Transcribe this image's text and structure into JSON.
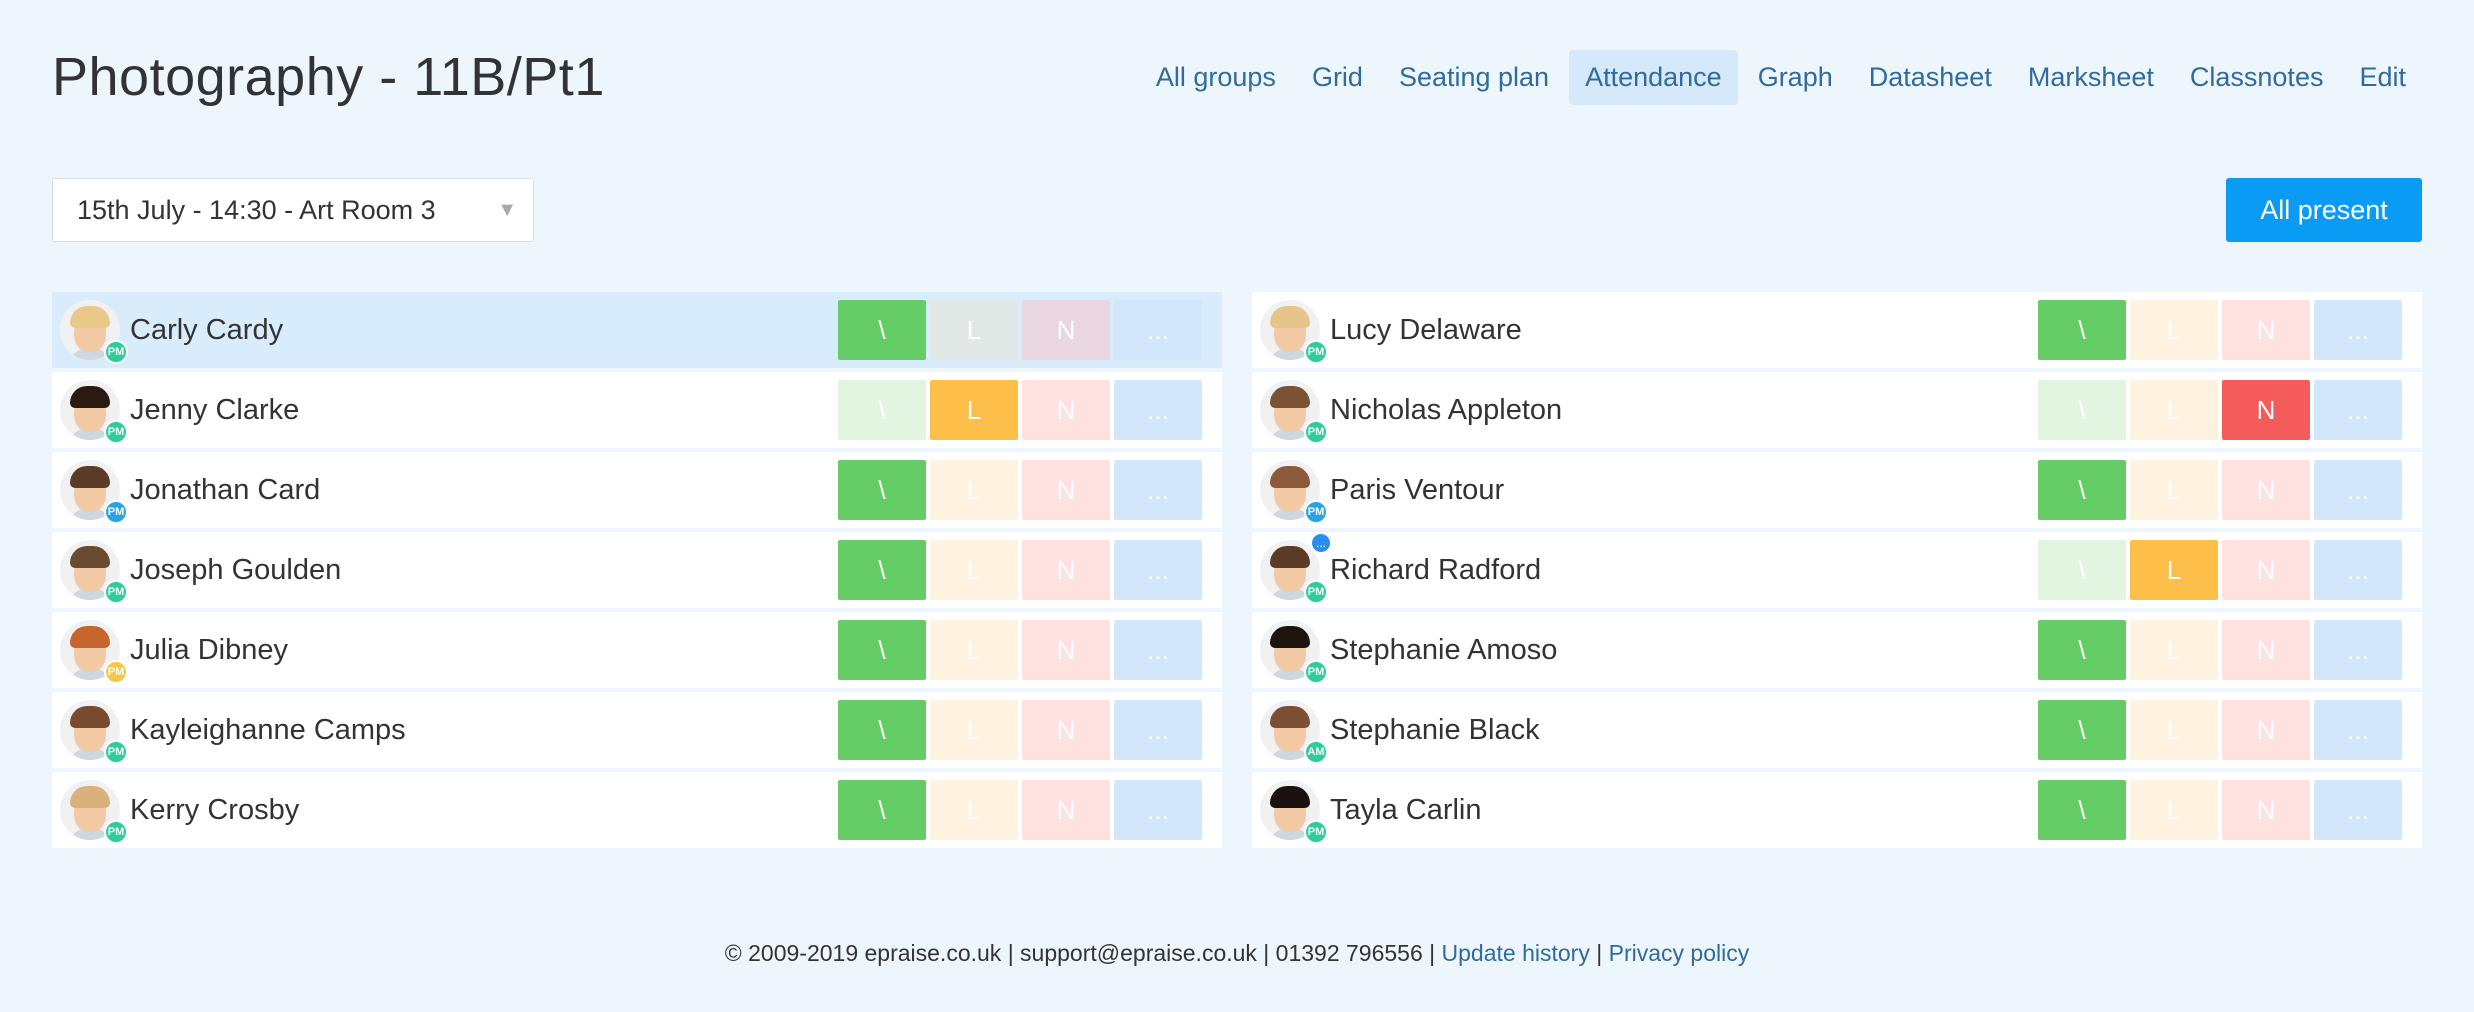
{
  "title": "Photography - 11B/Pt1",
  "nav": [
    {
      "label": "All groups",
      "active": false
    },
    {
      "label": "Grid",
      "active": false
    },
    {
      "label": "Seating plan",
      "active": false
    },
    {
      "label": "Attendance",
      "active": true
    },
    {
      "label": "Graph",
      "active": false
    },
    {
      "label": "Datasheet",
      "active": false
    },
    {
      "label": "Marksheet",
      "active": false
    },
    {
      "label": "Classnotes",
      "active": false
    },
    {
      "label": "Edit",
      "active": false
    }
  ],
  "session": {
    "selected": "15th July - 14:30 - Art Room 3"
  },
  "all_present_label": "All present",
  "mark_labels": {
    "present": "\\",
    "late": "L",
    "absent": "N",
    "other": "..."
  },
  "left_students": [
    {
      "name": "Carly Cardy",
      "badge": "PM",
      "status": "present",
      "selected": true
    },
    {
      "name": "Jenny Clarke",
      "badge": "PM",
      "status": "late"
    },
    {
      "name": "Jonathan Card",
      "badge": "PM",
      "status": "present"
    },
    {
      "name": "Joseph Goulden",
      "badge": "PM",
      "status": "present"
    },
    {
      "name": "Julia Dibney",
      "badge": "PM",
      "status": "present"
    },
    {
      "name": "Kayleighanne Camps",
      "badge": "PM",
      "status": "present"
    },
    {
      "name": "Kerry Crosby",
      "badge": "PM",
      "status": "present"
    }
  ],
  "right_students": [
    {
      "name": "Lucy Delaware",
      "badge": "PM",
      "status": "present"
    },
    {
      "name": "Nicholas Appleton",
      "badge": "PM",
      "status": "absent"
    },
    {
      "name": "Paris Ventour",
      "badge": "PM",
      "status": "present"
    },
    {
      "name": "Richard Radford",
      "badge": "PM",
      "status": "late",
      "note": "..."
    },
    {
      "name": "Stephanie Amoso",
      "badge": "PM",
      "status": "present"
    },
    {
      "name": "Stephanie Black",
      "badge": "AM",
      "status": "present"
    },
    {
      "name": "Tayla Carlin",
      "badge": "PM",
      "status": "present"
    }
  ],
  "footer": {
    "text": "© 2009-2019 epraise.co.uk | support@epraise.co.uk | 01392 796556 |",
    "update_history": "Update history",
    "separator": "|",
    "privacy_policy": "Privacy policy"
  },
  "colors": {
    "accent": "#0a9cf5",
    "present": "#66cc66",
    "late": "#fbbf4a",
    "absent": "#f45c5c",
    "other": "#d3e7fc",
    "link": "#2f6b9c"
  }
}
